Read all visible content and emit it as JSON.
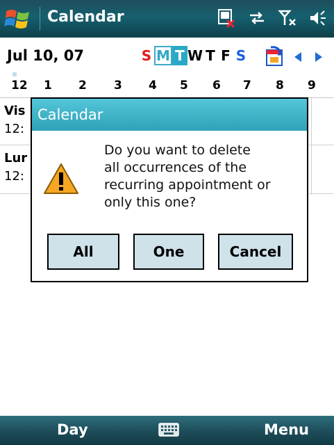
{
  "titlebar": {
    "title": "Calendar",
    "start_icon": "windows-start-icon",
    "status_icons": [
      "no-sim-icon",
      "connectivity-icon",
      "signal-off-icon",
      "volume-icon"
    ]
  },
  "date_nav": {
    "date": "Jul  10, 07",
    "weekdays": [
      "S",
      "M",
      "T",
      "W",
      "T",
      "F",
      "S"
    ],
    "selected_day": "M",
    "today_day": "T",
    "goto_today_icon": "goto-today-icon",
    "prev_icon": "left-arrow-icon",
    "next_icon": "right-arrow-icon"
  },
  "hours": [
    "12",
    "1",
    "2",
    "3",
    "4",
    "5",
    "6",
    "7",
    "8",
    "9"
  ],
  "appointments": [
    {
      "name": "Vis",
      "time": "12:"
    },
    {
      "name": "Lur",
      "time": "12:"
    }
  ],
  "dialog": {
    "title": "Calendar",
    "icon": "warning-icon",
    "message_lines": [
      "Do you want to delete",
      "all occurrences of the",
      "recurring appointment or",
      "only this one?"
    ],
    "buttons": {
      "all": "All",
      "one": "One",
      "cancel": "Cancel"
    }
  },
  "bottombar": {
    "left_softkey": "Day",
    "right_softkey": "Menu",
    "keyboard_icon": "keyboard-icon"
  },
  "colors": {
    "title_bg": "#16606f",
    "dialog_title_bg": "#3bb2c7",
    "button_bg": "#cfe2ea",
    "sunday": "#e31b1b",
    "saturday": "#1b5fe3",
    "accent": "#2aa9c7"
  }
}
